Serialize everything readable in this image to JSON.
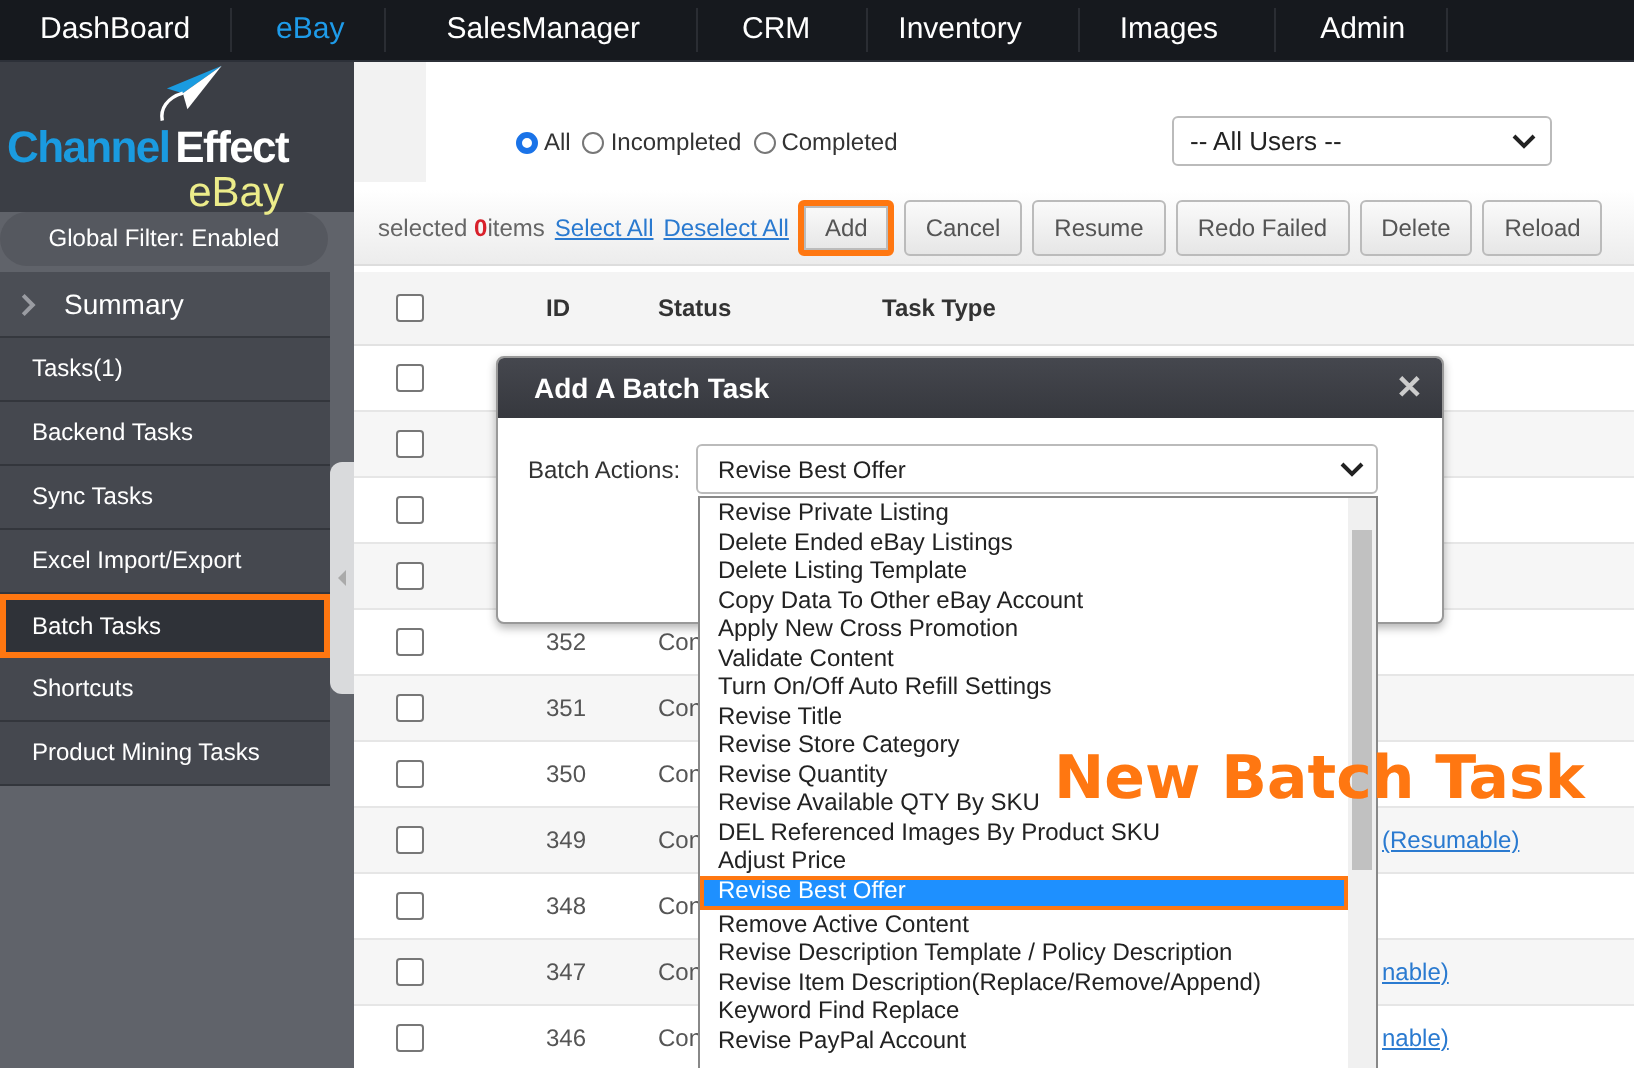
{
  "nav": {
    "items": [
      {
        "label": "DashBoard",
        "selected": false
      },
      {
        "label": "eBay",
        "selected": true
      },
      {
        "label": "SalesManager",
        "selected": false
      },
      {
        "label": "CRM",
        "selected": false
      },
      {
        "label": "Inventory",
        "selected": false
      },
      {
        "label": "Images",
        "selected": false
      },
      {
        "label": "Admin",
        "selected": false
      }
    ]
  },
  "sidebar": {
    "logo": {
      "word_1": "Channel",
      "word_2": "Effect",
      "product": "eBay"
    },
    "global_filter": "Global Filter: Enabled",
    "summary": "Summary",
    "items": [
      {
        "label": "Tasks(1)",
        "selected": false,
        "highlighted": false
      },
      {
        "label": "Backend Tasks",
        "selected": false,
        "highlighted": false
      },
      {
        "label": "Sync Tasks",
        "selected": false,
        "highlighted": false
      },
      {
        "label": "Excel Import/Export",
        "selected": false,
        "highlighted": false
      },
      {
        "label": "Batch Tasks",
        "selected": true,
        "highlighted": true
      },
      {
        "label": "Shortcuts",
        "selected": false,
        "highlighted": false
      },
      {
        "label": "Product Mining Tasks",
        "selected": false,
        "highlighted": false
      }
    ]
  },
  "filters": {
    "radios": [
      {
        "label": "All",
        "selected": true
      },
      {
        "label": "Incompleted",
        "selected": false
      },
      {
        "label": "Completed",
        "selected": false
      }
    ],
    "user_select": "-- All Users --"
  },
  "toolbar": {
    "selection": {
      "before": "selected ",
      "count": "0",
      "after": "items"
    },
    "links": [
      "Select All",
      "Deselect All"
    ],
    "buttons": [
      {
        "label": "Add",
        "highlighted": true
      },
      {
        "label": "Cancel",
        "highlighted": false
      },
      {
        "label": "Resume",
        "highlighted": false
      },
      {
        "label": "Redo Failed",
        "highlighted": false
      },
      {
        "label": "Delete",
        "highlighted": false
      },
      {
        "label": "Reload",
        "highlighted": false
      }
    ]
  },
  "table": {
    "header_checked": false,
    "columns": [
      "ID",
      "Status",
      "Task Type"
    ],
    "rows": [
      {
        "checked": false
      },
      {
        "checked": false
      },
      {
        "checked": false
      },
      {
        "checked": false
      },
      {
        "checked": false,
        "id": "352",
        "status": "Con"
      },
      {
        "checked": false,
        "id": "351",
        "status": "Con"
      },
      {
        "checked": false,
        "id": "350",
        "status": "Con"
      },
      {
        "checked": false,
        "id": "349",
        "status": "Con",
        "task_type": "(Resumable)"
      },
      {
        "checked": false,
        "id": "348",
        "status": "Con"
      },
      {
        "checked": false,
        "id": "347",
        "status": "Con",
        "task_type": "nable)"
      },
      {
        "checked": false,
        "id": "346",
        "status": "Con",
        "task_type": "nable)"
      }
    ]
  },
  "dialog": {
    "title": "Add A Batch Task",
    "close": "✕",
    "field_label": "Batch Actions:",
    "value": "Revise Best Offer",
    "options": [
      {
        "label": "Revise Private Listing",
        "selected": false,
        "highlighted": false
      },
      {
        "label": "Delete Ended eBay Listings",
        "selected": false,
        "highlighted": false
      },
      {
        "label": "Delete Listing Template",
        "selected": false,
        "highlighted": false
      },
      {
        "label": "Copy Data To Other eBay Account",
        "selected": false,
        "highlighted": false
      },
      {
        "label": "Apply New Cross Promotion",
        "selected": false,
        "highlighted": false
      },
      {
        "label": "Validate Content",
        "selected": false,
        "highlighted": false
      },
      {
        "label": "Turn On/Off Auto Refill Settings",
        "selected": false,
        "highlighted": false
      },
      {
        "label": "Revise Title",
        "selected": false,
        "highlighted": false
      },
      {
        "label": "Revise Store Category",
        "selected": false,
        "highlighted": false
      },
      {
        "label": "Revise Quantity",
        "selected": false,
        "highlighted": false
      },
      {
        "label": "Revise Available QTY By SKU",
        "selected": false,
        "highlighted": false
      },
      {
        "label": "DEL Referenced Images By Product SKU",
        "selected": false,
        "highlighted": false
      },
      {
        "label": "Adjust Price",
        "selected": false,
        "highlighted": false
      },
      {
        "label": "Revise Best Offer",
        "selected": true,
        "highlighted": true
      },
      {
        "label": "Remove Active Content",
        "selected": false,
        "highlighted": false
      },
      {
        "label": "Revise Description Template / Policy Description",
        "selected": false,
        "highlighted": false
      },
      {
        "label": "Revise Item Description(Replace/Remove/Append)",
        "selected": false,
        "highlighted": false
      },
      {
        "label": "Keyword Find Replace",
        "selected": false,
        "highlighted": false
      },
      {
        "label": "Revise PayPal Account",
        "selected": false,
        "highlighted": false
      }
    ]
  },
  "annotation": {
    "text": "New Batch Task"
  }
}
